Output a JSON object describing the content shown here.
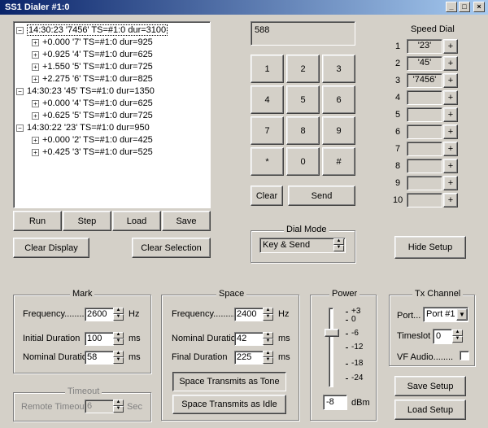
{
  "window": {
    "title": "SS1 Dialer #1:0"
  },
  "tree": {
    "groups": [
      {
        "label": "14:30:23 '7456' TS=#1:0 dur=3100",
        "selected": true,
        "children": [
          "+0.000 '7' TS=#1:0 dur=925",
          "+0.925 '4' TS=#1:0 dur=625",
          "+1.550 '5' TS=#1:0 dur=725",
          "+2.275 '6' TS=#1:0 dur=825"
        ]
      },
      {
        "label": "14:30:23 '45' TS=#1:0 dur=1350",
        "children": [
          "+0.000 '4' TS=#1:0 dur=625",
          "+0.625 '5' TS=#1:0 dur=725"
        ]
      },
      {
        "label": "14:30:22 '23' TS=#1:0 dur=950",
        "children": [
          "+0.000 '2' TS=#1:0 dur=425",
          "+0.425 '3' TS=#1:0 dur=525"
        ]
      }
    ]
  },
  "buttons": {
    "run": "Run",
    "step": "Step",
    "load": "Load",
    "save": "Save",
    "clear_display": "Clear Display",
    "clear_selection": "Clear Selection",
    "hide_setup": "Hide Setup",
    "save_setup": "Save Setup",
    "load_setup": "Load Setup",
    "clear": "Clear",
    "send": "Send"
  },
  "dial_display": "588",
  "keypad": [
    "1",
    "2",
    "3",
    "4",
    "5",
    "6",
    "7",
    "8",
    "9",
    "*",
    "0",
    "#"
  ],
  "dial_mode": {
    "label": "Dial Mode",
    "value": "Key & Send"
  },
  "speed_dial": {
    "title": "Speed Dial",
    "rows": [
      {
        "n": "1",
        "value": "'23'"
      },
      {
        "n": "2",
        "value": "'45'"
      },
      {
        "n": "3",
        "value": "'7456'"
      },
      {
        "n": "4",
        "value": ""
      },
      {
        "n": "5",
        "value": ""
      },
      {
        "n": "6",
        "value": ""
      },
      {
        "n": "7",
        "value": ""
      },
      {
        "n": "8",
        "value": ""
      },
      {
        "n": "9",
        "value": ""
      },
      {
        "n": "10",
        "value": ""
      }
    ],
    "plus": "+"
  },
  "mark": {
    "title": "Mark",
    "frequency_label": "Frequency..........",
    "frequency": "2600",
    "frequency_unit": "Hz",
    "initial_label": "Initial Duration",
    "initial": "100",
    "initial_unit": "ms",
    "nominal_label": "Nominal Duration",
    "nominal": "58",
    "nominal_unit": "ms"
  },
  "space": {
    "title": "Space",
    "frequency_label": "Frequency..........",
    "frequency": "2400",
    "frequency_unit": "Hz",
    "nominal_label": "Nominal Duration",
    "nominal": "42",
    "nominal_unit": "ms",
    "final_label": "Final Duration",
    "final": "225",
    "final_unit": "ms",
    "tone_button": "Space Transmits as Tone",
    "idle_button": "Space Transmits as Idle"
  },
  "timeout": {
    "title": "Timeout",
    "label": "Remote Timeout",
    "value": "6",
    "unit": "Sec"
  },
  "power": {
    "title": "Power",
    "ticks": [
      "+3",
      "0",
      "-6",
      "-12",
      "-18",
      "-24"
    ],
    "value": "-8",
    "unit": "dBm",
    "level_fraction": 0.27
  },
  "tx": {
    "title": "Tx Channel",
    "port_label": "Port...",
    "port": "Port #1",
    "timeslot_label": "Timeslot",
    "timeslot": "0",
    "vf_label": "VF Audio........"
  }
}
